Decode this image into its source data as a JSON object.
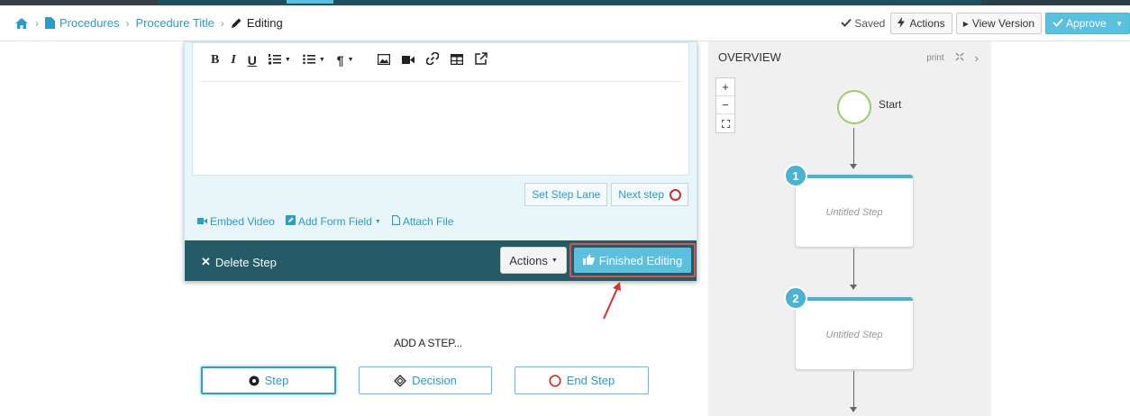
{
  "breadcrumb": {
    "items": [
      "Procedures",
      "Procedure Title"
    ],
    "current": "Editing"
  },
  "header": {
    "saved": "Saved",
    "actions": "Actions",
    "view_version": "View Version",
    "approve": "Approve"
  },
  "editor": {
    "toolbar": {
      "bold": "B",
      "italic": "I",
      "underline": "U"
    },
    "set_step_lane": "Set Step Lane",
    "next_step": "Next step",
    "embed_video": "Embed Video",
    "add_form_field": "Add Form Field",
    "attach_file": "Attach File",
    "delete_step": "Delete Step",
    "actions": "Actions",
    "finished_editing": "Finished Editing"
  },
  "add_step": {
    "title": "ADD A STEP...",
    "step": "Step",
    "decision": "Decision",
    "end_step": "End Step"
  },
  "overview": {
    "title": "OVERVIEW",
    "print": "print",
    "zoom_in": "+",
    "zoom_out": "−",
    "start_label": "Start",
    "nodes": [
      {
        "number": "1",
        "label": "Untitled Step"
      },
      {
        "number": "2",
        "label": "Untitled Step"
      }
    ]
  },
  "colors": {
    "accent": "#5bc0de",
    "footer": "#245b66",
    "highlight": "#d9534f"
  }
}
